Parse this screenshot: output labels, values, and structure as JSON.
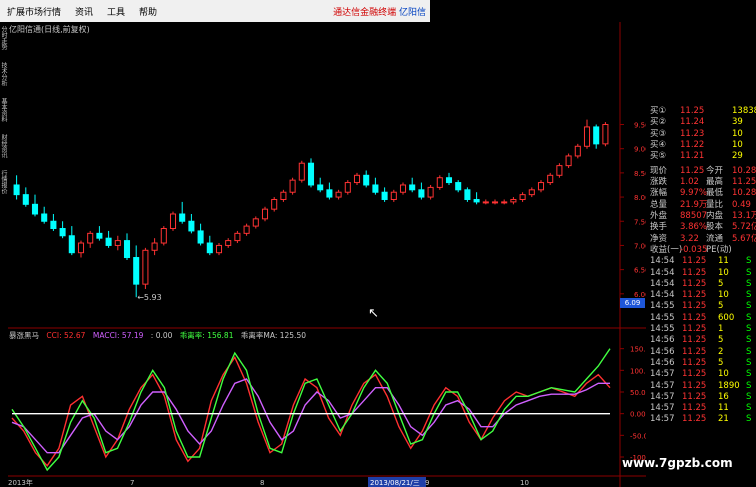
{
  "menu": {
    "items": [
      "扩展市场行情",
      "资讯",
      "工具",
      "帮助"
    ],
    "promo_red": "通达信金融终端",
    "promo_blue": "亿阳信"
  },
  "sidebar_tabs": [
    "分时走势",
    "技术分析",
    "基本资料",
    "财经资讯",
    "行情报价"
  ],
  "chart_title": "亿阳信通(日线,前复权)",
  "colors": {
    "up": "#ff3333",
    "down": "#00ffff",
    "grid": "#8b0000",
    "cci": "#ff3030",
    "macci": "#d060ff",
    "line3": "#40ff40",
    "line4": "#ffffff"
  },
  "indicator": {
    "name": "暴涨黑马",
    "labels": [
      {
        "text": "CCI: 52.67",
        "color": "#ff3030"
      },
      {
        "text": "MACCI: 57.19",
        "color": "#d060ff"
      },
      {
        "text": ": 0.00",
        "color": "#c8c8c8"
      },
      {
        "text": "乖离率: 156.81",
        "color": "#40ff40"
      },
      {
        "text": "乖离率MA: 125.50",
        "color": "#c8c8c8"
      }
    ]
  },
  "quote_panel": {
    "bids": [
      {
        "label": "买①",
        "price": "11.25",
        "vol": "138389"
      },
      {
        "label": "买②",
        "price": "11.24",
        "vol": "39"
      },
      {
        "label": "买③",
        "price": "11.23",
        "vol": "10"
      },
      {
        "label": "买④",
        "price": "11.22",
        "vol": "10"
      },
      {
        "label": "买⑤",
        "price": "11.21",
        "vol": "29"
      }
    ],
    "stats": [
      {
        "l1": "现价",
        "v1": "11.25",
        "l2": "今开",
        "v2": "10.28"
      },
      {
        "l1": "涨跌",
        "v1": "1.02",
        "l2": "最高",
        "v2": "11.25"
      },
      {
        "l1": "涨幅",
        "v1": "9.97%",
        "l2": "最低",
        "v2": "10.28"
      },
      {
        "l1": "总量",
        "v1": "21.9万",
        "l2": "量比",
        "v2": "0.49"
      },
      {
        "l1": "外盘",
        "v1": "88507",
        "l2": "内盘",
        "v2": "13.1万"
      },
      {
        "l1": "换手",
        "v1": "3.86%",
        "l2": "股本",
        "v2": "5.72亿"
      },
      {
        "l1": "净资",
        "v1": "3.22",
        "l2": "流通",
        "v2": "5.67亿"
      },
      {
        "l1": "收益(一)",
        "v1": "-0.035",
        "l2": "PE(动)",
        "v2": ""
      }
    ],
    "ticks": [
      {
        "time": "14:54",
        "price": "11.25",
        "vol": "11",
        "bs": "S"
      },
      {
        "time": "14:54",
        "price": "11.25",
        "vol": "10",
        "bs": "S"
      },
      {
        "time": "14:54",
        "price": "11.25",
        "vol": "5",
        "bs": "S"
      },
      {
        "time": "14:54",
        "price": "11.25",
        "vol": "10",
        "bs": "S"
      },
      {
        "time": "14:55",
        "price": "11.25",
        "vol": "5",
        "bs": "S"
      },
      {
        "time": "14:55",
        "price": "11.25",
        "vol": "600",
        "bs": "S"
      },
      {
        "time": "14:55",
        "price": "11.25",
        "vol": "1",
        "bs": "S"
      },
      {
        "time": "14:56",
        "price": "11.25",
        "vol": "5",
        "bs": "S"
      },
      {
        "time": "14:56",
        "price": "11.25",
        "vol": "2",
        "bs": "S"
      },
      {
        "time": "14:56",
        "price": "11.25",
        "vol": "5",
        "bs": "S"
      },
      {
        "time": "14:57",
        "price": "11.25",
        "vol": "10",
        "bs": "S"
      },
      {
        "time": "14:57",
        "price": "11.25",
        "vol": "1890",
        "bs": "S"
      },
      {
        "time": "14:57",
        "price": "11.25",
        "vol": "16",
        "bs": "S"
      },
      {
        "time": "14:57",
        "price": "11.25",
        "vol": "11",
        "bs": "S"
      },
      {
        "time": "14:57",
        "price": "11.25",
        "vol": "21",
        "bs": "S"
      }
    ]
  },
  "chart_data": [
    {
      "type": "candlestick",
      "title": "亿阳信通(日线,前复权)",
      "y_ticks": [
        "9.50",
        "9.00",
        "8.50",
        "8.00",
        "7.50",
        "7.00",
        "6.50",
        "6.00"
      ],
      "ylim": [
        5.5,
        9.8
      ],
      "current_price_tag": "6.09",
      "annotations": [
        {
          "text": "←5.93"
        }
      ],
      "grid": true,
      "candles": [
        [
          8.25,
          8.45,
          7.95,
          8.05
        ],
        [
          8.05,
          8.2,
          7.8,
          7.85
        ],
        [
          7.85,
          8.05,
          7.6,
          7.65
        ],
        [
          7.65,
          7.8,
          7.45,
          7.5
        ],
        [
          7.5,
          7.65,
          7.3,
          7.35
        ],
        [
          7.35,
          7.5,
          7.15,
          7.2
        ],
        [
          7.2,
          7.4,
          6.8,
          6.85
        ],
        [
          6.85,
          7.1,
          6.75,
          7.05
        ],
        [
          7.05,
          7.3,
          6.95,
          7.25
        ],
        [
          7.25,
          7.4,
          7.1,
          7.15
        ],
        [
          7.15,
          7.3,
          6.95,
          7.0
        ],
        [
          7.0,
          7.2,
          6.9,
          7.1
        ],
        [
          7.1,
          7.25,
          6.7,
          6.75
        ],
        [
          6.75,
          7.0,
          5.93,
          6.2
        ],
        [
          6.2,
          6.95,
          6.1,
          6.9
        ],
        [
          6.9,
          7.15,
          6.8,
          7.05
        ],
        [
          7.05,
          7.4,
          7.0,
          7.35
        ],
        [
          7.35,
          7.7,
          7.3,
          7.65
        ],
        [
          7.65,
          7.9,
          7.45,
          7.5
        ],
        [
          7.5,
          7.65,
          7.25,
          7.3
        ],
        [
          7.3,
          7.45,
          7.0,
          7.05
        ],
        [
          7.05,
          7.2,
          6.8,
          6.85
        ],
        [
          6.85,
          7.05,
          6.8,
          7.0
        ],
        [
          7.0,
          7.15,
          6.95,
          7.1
        ],
        [
          7.1,
          7.3,
          7.05,
          7.25
        ],
        [
          7.25,
          7.45,
          7.2,
          7.4
        ],
        [
          7.4,
          7.6,
          7.35,
          7.55
        ],
        [
          7.55,
          7.8,
          7.5,
          7.75
        ],
        [
          7.75,
          8.0,
          7.7,
          7.95
        ],
        [
          7.95,
          8.15,
          7.9,
          8.1
        ],
        [
          8.1,
          8.4,
          8.05,
          8.35
        ],
        [
          8.35,
          8.75,
          8.3,
          8.7
        ],
        [
          8.7,
          8.8,
          8.2,
          8.25
        ],
        [
          8.25,
          8.4,
          8.1,
          8.15
        ],
        [
          8.15,
          8.3,
          7.95,
          8.0
        ],
        [
          8.0,
          8.15,
          7.95,
          8.1
        ],
        [
          8.1,
          8.35,
          8.05,
          8.3
        ],
        [
          8.3,
          8.5,
          8.25,
          8.45
        ],
        [
          8.45,
          8.55,
          8.2,
          8.25
        ],
        [
          8.25,
          8.4,
          8.05,
          8.1
        ],
        [
          8.1,
          8.2,
          7.9,
          7.95
        ],
        [
          7.95,
          8.15,
          7.9,
          8.1
        ],
        [
          8.1,
          8.3,
          8.05,
          8.25
        ],
        [
          8.25,
          8.4,
          8.1,
          8.15
        ],
        [
          8.15,
          8.3,
          7.95,
          8.0
        ],
        [
          8.0,
          8.25,
          7.95,
          8.2
        ],
        [
          8.2,
          8.45,
          8.15,
          8.4
        ],
        [
          8.4,
          8.5,
          8.25,
          8.3
        ],
        [
          8.3,
          8.35,
          8.1,
          8.15
        ],
        [
          8.15,
          8.2,
          7.9,
          7.95
        ],
        [
          7.95,
          8.1,
          7.85,
          7.9
        ],
        [
          7.9,
          7.95,
          7.85,
          7.9
        ],
        [
          7.9,
          7.95,
          7.85,
          7.9
        ],
        [
          7.9,
          7.95,
          7.85,
          7.9
        ],
        [
          7.9,
          8.0,
          7.85,
          7.95
        ],
        [
          7.95,
          8.1,
          7.9,
          8.05
        ],
        [
          8.05,
          8.2,
          8.0,
          8.15
        ],
        [
          8.15,
          8.35,
          8.1,
          8.3
        ],
        [
          8.3,
          8.5,
          8.25,
          8.45
        ],
        [
          8.45,
          8.7,
          8.4,
          8.65
        ],
        [
          8.65,
          8.9,
          8.6,
          8.85
        ],
        [
          8.85,
          9.1,
          8.8,
          9.05
        ],
        [
          9.05,
          9.6,
          9.0,
          9.45
        ],
        [
          9.45,
          9.5,
          9.0,
          9.1
        ],
        [
          9.1,
          9.55,
          9.05,
          9.5
        ]
      ]
    },
    {
      "type": "line",
      "title": "暴涨黑马",
      "y_ticks": [
        "150.00",
        "100.00",
        "50.00",
        "0.00",
        "-50.00",
        "-100.00"
      ],
      "ylim": [
        -130,
        170
      ],
      "x_labels": [
        "2013年",
        "7",
        "8",
        "2013/08/21/三",
        "9",
        "10"
      ],
      "series": [
        {
          "name": "CCI",
          "color": "#ff3030",
          "values": [
            -10,
            -40,
            -90,
            -120,
            -80,
            20,
            40,
            -30,
            -100,
            -60,
            10,
            60,
            90,
            40,
            -60,
            -110,
            -80,
            30,
            90,
            130,
            70,
            -20,
            -90,
            -70,
            20,
            80,
            60,
            -10,
            -50,
            20,
            70,
            90,
            40,
            -30,
            -80,
            -40,
            20,
            60,
            40,
            -20,
            -60,
            -10,
            30,
            50,
            40,
            50,
            60,
            50,
            40,
            70,
            90,
            60
          ]
        },
        {
          "name": "MACCI",
          "color": "#d060ff",
          "values": [
            -20,
            -30,
            -60,
            -90,
            -90,
            -50,
            -10,
            0,
            -40,
            -60,
            -30,
            20,
            50,
            50,
            10,
            -40,
            -70,
            -40,
            20,
            70,
            80,
            40,
            -20,
            -60,
            -40,
            20,
            50,
            30,
            -10,
            0,
            30,
            60,
            60,
            20,
            -30,
            -50,
            -20,
            20,
            30,
            10,
            -30,
            -30,
            0,
            20,
            30,
            40,
            45,
            45,
            45,
            55,
            70,
            70
          ]
        },
        {
          "name": "乖离率",
          "color": "#40ff40",
          "values": [
            10,
            -30,
            -80,
            -130,
            -100,
            -20,
            30,
            -10,
            -90,
            -80,
            -20,
            50,
            100,
            60,
            -40,
            -100,
            -100,
            -10,
            80,
            140,
            100,
            0,
            -80,
            -90,
            0,
            70,
            80,
            20,
            -40,
            0,
            60,
            100,
            70,
            0,
            -70,
            -60,
            0,
            50,
            50,
            0,
            -60,
            -40,
            10,
            40,
            40,
            50,
            60,
            55,
            50,
            80,
            110,
            150
          ]
        },
        {
          "name": "乖离率MA",
          "color": "#ffffff",
          "values": [
            0,
            0,
            0,
            0,
            0,
            0,
            0,
            0,
            0,
            0,
            0,
            0,
            0,
            0,
            0,
            0,
            0,
            0,
            0,
            0,
            0,
            0,
            0,
            0,
            0,
            0,
            0,
            0,
            0,
            0,
            0,
            0,
            0,
            0,
            0,
            0,
            0,
            0,
            0,
            0,
            0,
            0,
            0,
            0,
            0,
            0,
            0,
            0,
            0,
            0,
            0,
            0
          ]
        }
      ]
    }
  ]
}
